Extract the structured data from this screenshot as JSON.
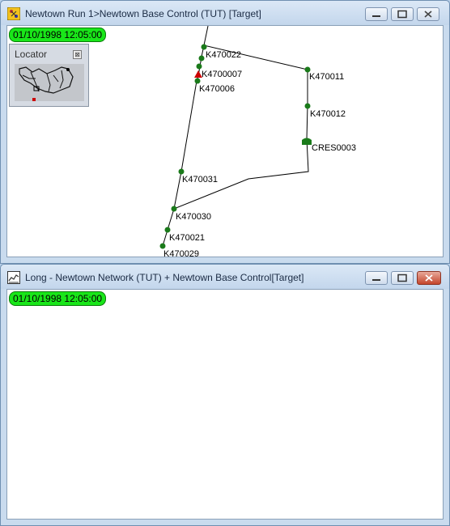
{
  "window_top": {
    "title": "Newtown Run 1>Newtown Base Control (TUT)  [Target]",
    "timestamp": "01/10/1998 12:05:00",
    "locator": {
      "title": "Locator",
      "close_glyph": "⊠"
    },
    "map_labels": {
      "k470022": "K470022",
      "k4700007": "K4700007",
      "k470006": "K470006",
      "k470011": "K470011",
      "k470012": "K470012",
      "cres0003": "CRES0003",
      "k470031": "K470031",
      "k470030": "K470030",
      "k470021": "K470021",
      "k470029": "K470029"
    }
  },
  "window_bottom": {
    "title": "Long - Newtown Network (TUT) + Newtown Base Control[Target]",
    "timestamp": "01/10/1998 12:05:00"
  },
  "colors": {
    "node": "#1a7a1a",
    "timestamp_bg": "#19e619",
    "highlight_node": "#cc0000"
  }
}
